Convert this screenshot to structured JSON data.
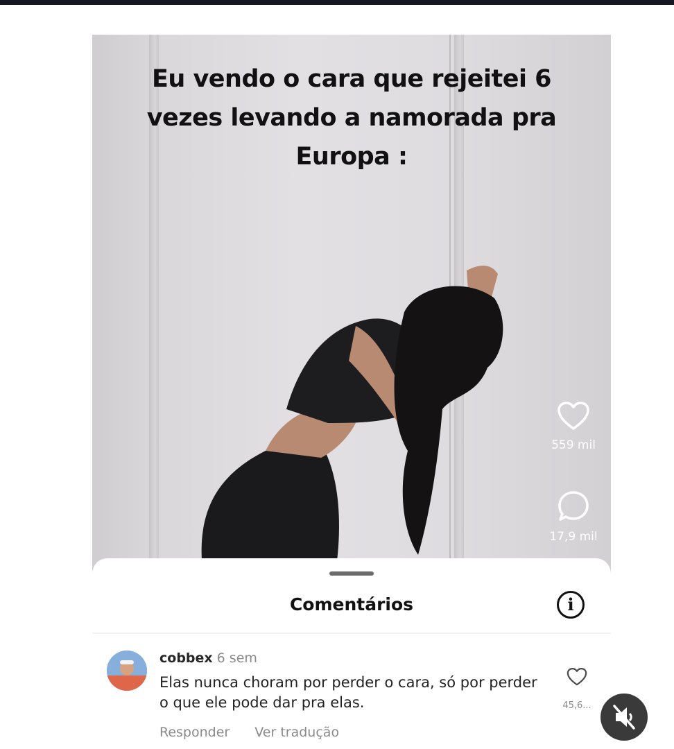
{
  "video": {
    "caption_lines": [
      "Eu vendo o cara que rejeitei 6",
      "vezes levando a namorada pra",
      "Europa :"
    ],
    "likes_count": "559 mil",
    "comments_count": "17,9 mil",
    "like_icon": "heart-outline-icon",
    "comment_icon": "speech-bubble-icon"
  },
  "sheet": {
    "title": "Comentários",
    "info_icon": "info-icon"
  },
  "comment": {
    "username": "cobbex",
    "time": "6 sem",
    "text": "Elas nunca choram por perder o cara, só por perder o que ele pode dar pra elas.",
    "reply_label": "Responder",
    "translate_label": "Ver tradução",
    "like_count": "45,6...",
    "like_icon": "heart-outline-icon"
  },
  "overlay": {
    "mute_icon": "speaker-muted-icon"
  }
}
